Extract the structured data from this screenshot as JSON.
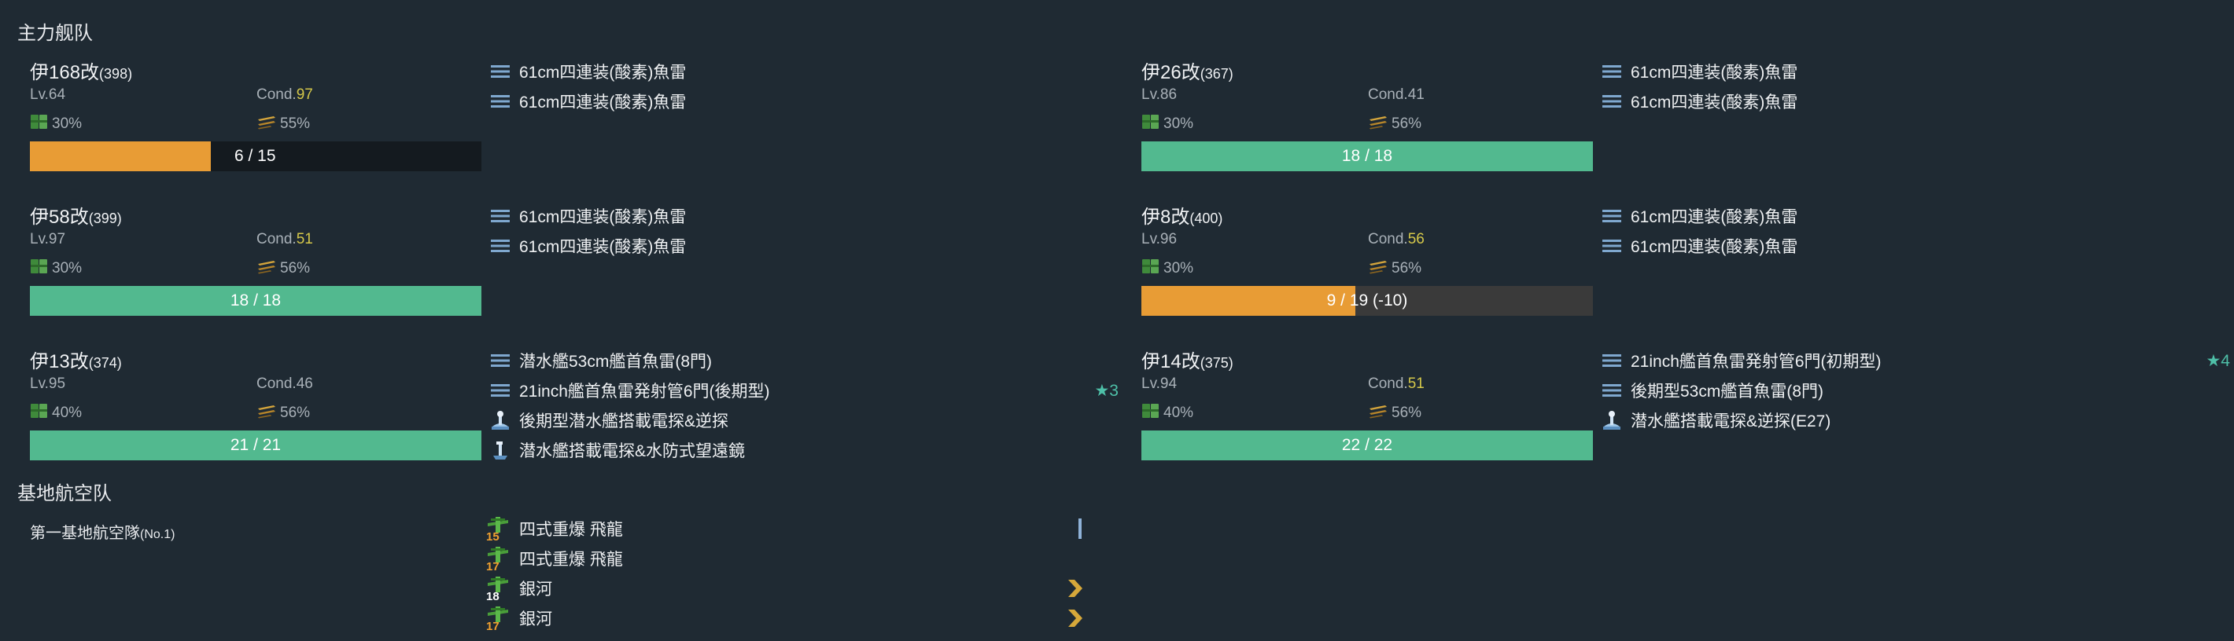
{
  "fleet": {
    "title": "主力舰队",
    "ships": [
      {
        "name": "伊168改",
        "id": "(398)",
        "level": "Lv.64",
        "cond_label": "Cond.",
        "cond": "97",
        "cond_good": true,
        "fuel": "30%",
        "ammo": "55%",
        "hp_text": "6 / 15",
        "hp_fraction": 0.4,
        "hp_color": "#e89c35",
        "equips": [
          {
            "icon": "torpedo-icon",
            "name": "61cm四連装(酸素)魚雷",
            "star": ""
          },
          {
            "icon": "torpedo-icon",
            "name": "61cm四連装(酸素)魚雷",
            "star": ""
          }
        ]
      },
      {
        "name": "伊26改",
        "id": "(367)",
        "level": "Lv.86",
        "cond_label": "Cond.",
        "cond": "41",
        "cond_good": false,
        "fuel": "30%",
        "ammo": "56%",
        "hp_text": "18 / 18",
        "hp_fraction": 1.0,
        "hp_color": "#52b98f",
        "equips": [
          {
            "icon": "torpedo-icon",
            "name": "61cm四連装(酸素)魚雷",
            "star": ""
          },
          {
            "icon": "torpedo-icon",
            "name": "61cm四連装(酸素)魚雷",
            "star": ""
          }
        ]
      },
      {
        "name": "伊58改",
        "id": "(399)",
        "level": "Lv.97",
        "cond_label": "Cond.",
        "cond": "51",
        "cond_good": true,
        "fuel": "30%",
        "ammo": "56%",
        "hp_text": "18 / 18",
        "hp_fraction": 1.0,
        "hp_color": "#52b98f",
        "equips": [
          {
            "icon": "torpedo-icon",
            "name": "61cm四連装(酸素)魚雷",
            "star": ""
          },
          {
            "icon": "torpedo-icon",
            "name": "61cm四連装(酸素)魚雷",
            "star": ""
          }
        ]
      },
      {
        "name": "伊8改",
        "id": "(400)",
        "level": "Lv.96",
        "cond_label": "Cond.",
        "cond": "56",
        "cond_good": true,
        "fuel": "30%",
        "ammo": "56%",
        "hp_text": "9 / 19 (-10)",
        "hp_fraction": 0.474,
        "hp_color": "#e89c35",
        "equips": [
          {
            "icon": "torpedo-icon",
            "name": "61cm四連装(酸素)魚雷",
            "star": ""
          },
          {
            "icon": "torpedo-icon",
            "name": "61cm四連装(酸素)魚雷",
            "star": ""
          }
        ]
      },
      {
        "name": "伊13改",
        "id": "(374)",
        "level": "Lv.95",
        "cond_label": "Cond.",
        "cond": "46",
        "cond_good": false,
        "fuel": "40%",
        "ammo": "56%",
        "hp_text": "21 / 21",
        "hp_fraction": 1.0,
        "hp_color": "#52b98f",
        "equips": [
          {
            "icon": "torpedo-icon",
            "name": "潜水艦53cm艦首魚雷(8門)",
            "star": ""
          },
          {
            "icon": "torpedo-icon",
            "name": "21inch艦首魚雷発射管6門(後期型)",
            "star": "★3"
          },
          {
            "icon": "radar-icon",
            "name": "後期型潜水艦搭載電探&逆探",
            "star": ""
          },
          {
            "icon": "periscope-icon",
            "name": "潜水艦搭載電探&水防式望遠鏡",
            "star": ""
          }
        ]
      },
      {
        "name": "伊14改",
        "id": "(375)",
        "level": "Lv.94",
        "cond_label": "Cond.",
        "cond": "51",
        "cond_good": true,
        "fuel": "40%",
        "ammo": "56%",
        "hp_text": "22 / 22",
        "hp_fraction": 1.0,
        "hp_color": "#52b98f",
        "equips": [
          {
            "icon": "torpedo-icon",
            "name": "21inch艦首魚雷発射管6門(初期型)",
            "star": "★4"
          },
          {
            "icon": "torpedo-icon",
            "name": "後期型53cm艦首魚雷(8門)",
            "star": ""
          },
          {
            "icon": "radar-icon",
            "name": "潜水艦搭載電探&逆探(E27)",
            "star": ""
          }
        ]
      }
    ]
  },
  "lbas": {
    "title": "基地航空队",
    "corps_name": "第一基地航空隊",
    "corps_no": "(No.1)",
    "equips": [
      {
        "count": "15",
        "count_color": "orange",
        "name": "四式重爆 飛龍",
        "prof": "bar"
      },
      {
        "count": "17",
        "count_color": "orange",
        "name": "四式重爆 飛龍",
        "prof": ""
      },
      {
        "count": "18",
        "count_color": "white",
        "name": "銀河",
        "prof": "chevron"
      },
      {
        "count": "17",
        "count_color": "orange",
        "name": "銀河",
        "prof": "chevron"
      }
    ]
  },
  "colors": {
    "hp_green": "#52b98f",
    "hp_orange": "#e89c35",
    "cond_yellow": "#d5c84a",
    "star_teal": "#4ec0a8"
  }
}
